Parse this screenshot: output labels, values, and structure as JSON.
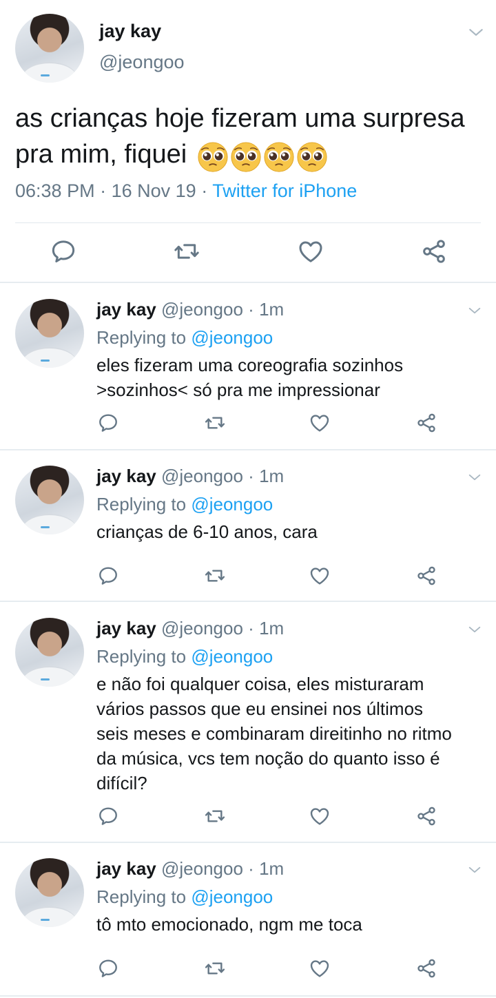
{
  "main_tweet": {
    "name": "jay kay",
    "handle": "@jeongoo",
    "text": "as crianças hoje fizeram uma surpresa pra mim, fiquei",
    "emoji": [
      "pleading-face",
      "pleading-face",
      "pleading-face",
      "pleading-face"
    ],
    "time": "06:38 PM",
    "date": "16 Nov 19",
    "dot": "·",
    "source": "Twitter for iPhone"
  },
  "replies": [
    {
      "name": "jay kay",
      "handle": "@jeongoo",
      "time_ago": "1m",
      "replying_prefix": "Replying to",
      "replying_to": "@jeongoo",
      "lines": [
        "eles fizeram uma coreografia sozinhos",
        ">sozinhos< só pra me impressionar"
      ]
    },
    {
      "name": "jay kay",
      "handle": "@jeongoo",
      "time_ago": "1m",
      "replying_prefix": "Replying to",
      "replying_to": "@jeongoo",
      "lines": [
        "crianças de 6-10 anos, cara"
      ]
    },
    {
      "name": "jay kay",
      "handle": "@jeongoo",
      "time_ago": "1m",
      "replying_prefix": "Replying to",
      "replying_to": "@jeongoo",
      "lines": [
        "e não foi qualquer coisa, eles misturaram",
        "vários passos que eu ensinei nos últimos",
        "seis meses e combinaram direitinho no ritmo",
        "da música, vcs tem noção do quanto isso é",
        "difícil?"
      ]
    },
    {
      "name": "jay kay",
      "handle": "@jeongoo",
      "time_ago": "1m",
      "replying_prefix": "Replying to",
      "replying_to": "@jeongoo",
      "lines": [
        "tô mto emocionado, ngm me toca"
      ]
    }
  ],
  "icons": {
    "reply": "reply-icon",
    "retweet": "retweet-icon",
    "like": "like-icon",
    "share": "share-icon",
    "caret": "chevron-down-icon"
  },
  "colors": {
    "text": "#14171a",
    "secondary": "#657786",
    "link": "#1da1f2",
    "icon": "#657786",
    "divider": "#e6ecf0"
  }
}
